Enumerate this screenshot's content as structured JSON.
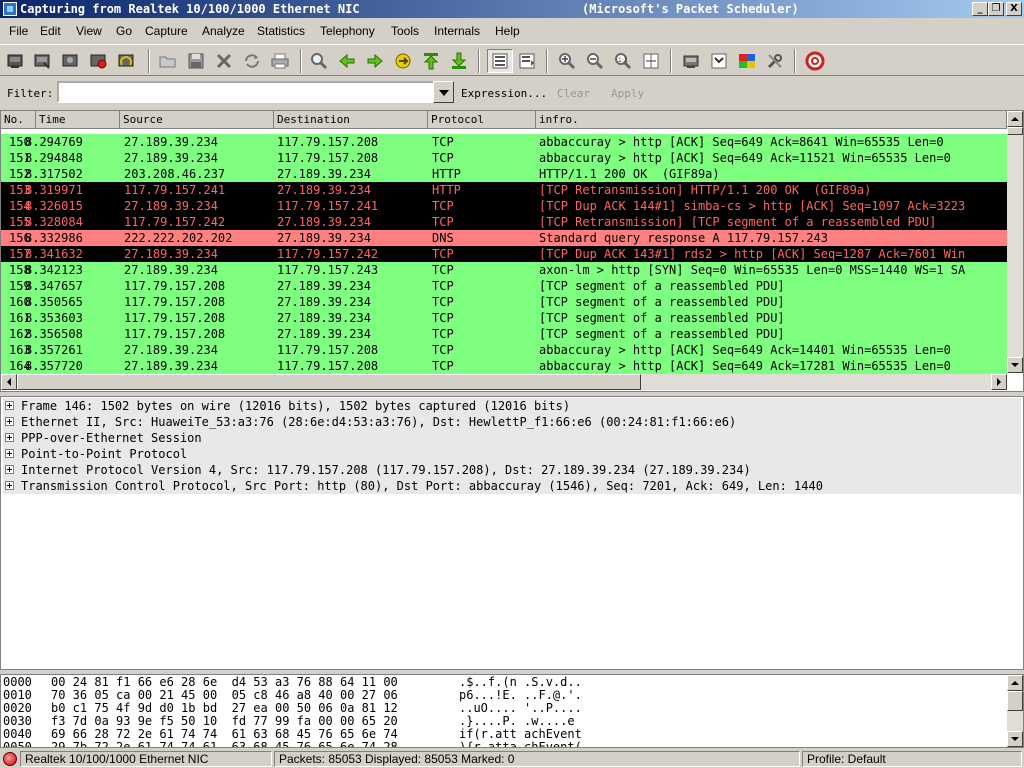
{
  "window": {
    "title": "Capturing from Realtek 10/100/1000 Ethernet NIC",
    "title_right": "(Microsoft's Packet Scheduler)",
    "minimize_label": "_",
    "maximize_label": "❐",
    "close_label": "X"
  },
  "menu": [
    "File",
    "Edit",
    "View",
    "Go",
    "Capture",
    "Analyze",
    "Statistics",
    "Telephony",
    "Tools",
    "Internals",
    "Help"
  ],
  "toolbar": {
    "icons": [
      "interfaces-icon",
      "options-icon",
      "start-icon",
      "stop-icon",
      "restart-icon",
      "open-icon",
      "save-icon",
      "close-file-icon",
      "reload-icon",
      "print-icon",
      "find-icon",
      "back-icon",
      "forward-icon",
      "go-to-icon",
      "first-icon",
      "last-icon",
      "colorize-icon",
      "autoscroll-icon",
      "zoom-in-icon",
      "zoom-out-icon",
      "normal-size-icon",
      "resize-columns-icon",
      "capture-filters-icon",
      "display-filters-icon",
      "coloring-rules-icon",
      "preferences-icon",
      "help-icon"
    ]
  },
  "filter": {
    "label": "Filter:",
    "value": "",
    "expression_label": "Expression...",
    "clear_label": "Clear",
    "apply_label": "Apply"
  },
  "packet_list": {
    "columns": [
      "No.",
      "Time",
      "Source",
      "Destination",
      "Protocol",
      "infro."
    ],
    "rows": [
      {
        "no": "150",
        "time": "8.294769",
        "src": "27.189.39.234",
        "dst": "117.79.157.208",
        "proto": "TCP",
        "info": "abbaccuray > http [ACK] Seq=649 Ack=8641 Win=65535 Len=0",
        "style": "green"
      },
      {
        "no": "151",
        "time": "8.294848",
        "src": "27.189.39.234",
        "dst": "117.79.157.208",
        "proto": "TCP",
        "info": "abbaccuray > http [ACK] Seq=649 Ack=11521 Win=65535 Len=0",
        "style": "green"
      },
      {
        "no": "152",
        "time": "8.317502",
        "src": "203.208.46.237",
        "dst": "27.189.39.234",
        "proto": "HTTP",
        "info": "HTTP/1.1 200 OK  (GIF89a)",
        "style": "green"
      },
      {
        "no": "153",
        "time": "8.319971",
        "src": "117.79.157.241",
        "dst": "27.189.39.234",
        "proto": "HTTP",
        "info": "[TCP Retransmission] HTTP/1.1 200 OK  (GIF89a)",
        "style": "black"
      },
      {
        "no": "154",
        "time": "8.326015",
        "src": "27.189.39.234",
        "dst": "117.79.157.241",
        "proto": "TCP",
        "info": "[TCP Dup ACK 144#1] simba-cs > http [ACK] Seq=1097 Ack=3223",
        "style": "black"
      },
      {
        "no": "155",
        "time": "8.328084",
        "src": "117.79.157.242",
        "dst": "27.189.39.234",
        "proto": "TCP",
        "info": "[TCP Retransmission] [TCP segment of a reassembled PDU]",
        "style": "black"
      },
      {
        "no": "156",
        "time": "8.332986",
        "src": "222.222.202.202",
        "dst": "27.189.39.234",
        "proto": "DNS",
        "info": "Standard query response A 117.79.157.243",
        "style": "red"
      },
      {
        "no": "157",
        "time": "8.341632",
        "src": "27.189.39.234",
        "dst": "117.79.157.242",
        "proto": "TCP",
        "info": "[TCP Dup ACK 143#1] rds2 > http [ACK] Seq=1287 Ack=7601 Win",
        "style": "black"
      },
      {
        "no": "158",
        "time": "8.342123",
        "src": "27.189.39.234",
        "dst": "117.79.157.243",
        "proto": "TCP",
        "info": "axon-lm > http [SYN] Seq=0 Win=65535 Len=0 MSS=1440 WS=1 SA",
        "style": "green"
      },
      {
        "no": "159",
        "time": "8.347657",
        "src": "117.79.157.208",
        "dst": "27.189.39.234",
        "proto": "TCP",
        "info": "[TCP segment of a reassembled PDU]",
        "style": "green"
      },
      {
        "no": "160",
        "time": "8.350565",
        "src": "117.79.157.208",
        "dst": "27.189.39.234",
        "proto": "TCP",
        "info": "[TCP segment of a reassembled PDU]",
        "style": "green"
      },
      {
        "no": "161",
        "time": "8.353603",
        "src": "117.79.157.208",
        "dst": "27.189.39.234",
        "proto": "TCP",
        "info": "[TCP segment of a reassembled PDU]",
        "style": "green"
      },
      {
        "no": "162",
        "time": "8.356508",
        "src": "117.79.157.208",
        "dst": "27.189.39.234",
        "proto": "TCP",
        "info": "[TCP segment of a reassembled PDU]",
        "style": "green"
      },
      {
        "no": "163",
        "time": "8.357261",
        "src": "27.189.39.234",
        "dst": "117.79.157.208",
        "proto": "TCP",
        "info": "abbaccuray > http [ACK] Seq=649 Ack=14401 Win=65535 Len=0",
        "style": "green"
      },
      {
        "no": "164",
        "time": "8.357720",
        "src": "27.189.39.234",
        "dst": "117.79.157.208",
        "proto": "TCP",
        "info": "abbaccuray > http [ACK] Seq=649 Ack=17281 Win=65535 Len=0",
        "style": "green"
      }
    ]
  },
  "details": [
    "Frame 146: 1502 bytes on wire (12016 bits), 1502 bytes captured (12016 bits)",
    "Ethernet II, Src: HuaweiTe_53:a3:76 (28:6e:d4:53:a3:76), Dst: HewlettP_f1:66:e6 (00:24:81:f1:66:e6)",
    "PPP-over-Ethernet Session",
    "Point-to-Point Protocol",
    "Internet Protocol Version 4, Src: 117.79.157.208 (117.79.157.208), Dst: 27.189.39.234 (27.189.39.234)",
    "Transmission Control Protocol, Src Port: http (80), Dst Port: abbaccuray (1546), Seq: 7201, Ack: 649, Len: 1440"
  ],
  "hex": [
    {
      "offset": "0000",
      "hex": "00 24 81 f1 66 e6 28 6e  d4 53 a3 76 88 64 11 00",
      "ascii": ".$..f.(n .S.v.d.."
    },
    {
      "offset": "0010",
      "hex": "70 36 05 ca 00 21 45 00  05 c8 46 a8 40 00 27 06",
      "ascii": "p6...!E. ..F.@.'."
    },
    {
      "offset": "0020",
      "hex": "b0 c1 75 4f 9d d0 1b bd  27 ea 00 50 06 0a 81 12",
      "ascii": "..uO.... '..P...."
    },
    {
      "offset": "0030",
      "hex": "f3 7d 0a 93 9e f5 50 10  fd 77 99 fa 00 00 65 20",
      "ascii": ".}....P. .w....e "
    },
    {
      "offset": "0040",
      "hex": "69 66 28 72 2e 61 74 74  61 63 68 45 76 65 6e 74",
      "ascii": "if(r.att achEvent"
    },
    {
      "offset": "0050",
      "hex": "29 7b 72 2e 61 74 74 61  63 68 45 76 65 6e 74 28",
      "ascii": "){r.atta chEvent("
    }
  ],
  "status": {
    "interface": "Realtek 10/100/1000 Ethernet NIC",
    "packets": "Packets: 85053 Displayed: 85053 Marked: 0",
    "profile": "Profile: Default"
  }
}
